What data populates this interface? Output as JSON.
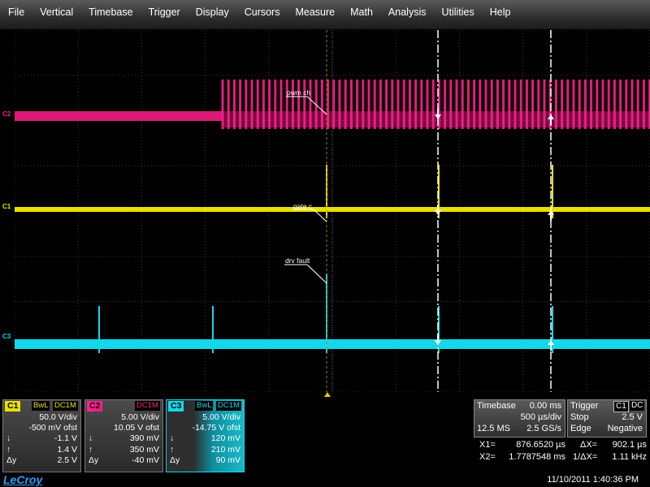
{
  "menu": [
    "File",
    "Vertical",
    "Timebase",
    "Trigger",
    "Display",
    "Cursors",
    "Measure",
    "Math",
    "Analysis",
    "Utilities",
    "Help"
  ],
  "colors": {
    "c1": "#e8e000",
    "c2": "#ff1e8c",
    "c3": "#14d7ea",
    "grid": "#2a2a2a",
    "trigger": "#e8c800"
  },
  "screen": {
    "channel_markers": {
      "c1": "C1",
      "c2": "C2",
      "c3": "C3"
    },
    "traces": {
      "c2": "pwm ch",
      "c1": "gate c",
      "c3": "drv fault"
    }
  },
  "panels": [
    {
      "name": "C1",
      "color": "#e8e000",
      "tags": [
        "BwL",
        "DC1M"
      ],
      "vdiv": "50.0 V/div",
      "ofst": "-500 mV ofst",
      "down": "-1.1 V",
      "up": "1.4 V",
      "dy": "2.5 V"
    },
    {
      "name": "C2",
      "color": "#ff1e8c",
      "tags": [
        "DC1M"
      ],
      "vdiv": "5.00 V/div",
      "ofst": "10.05 V ofst",
      "down": "390 mV",
      "up": "350 mV",
      "dy": "-40 mV"
    },
    {
      "name": "C3",
      "color": "#14d7ea",
      "tags": [
        "BwL",
        "DC1M"
      ],
      "vdiv": "5.00 V/div",
      "ofst": "-14.75 V ofst",
      "down": "120 mV",
      "up": "210 mV",
      "dy": "90 mV"
    }
  ],
  "symbols": {
    "down": "↓",
    "up": "↑",
    "dy": "Δy"
  },
  "timebase": {
    "label": "Timebase",
    "delay": "0.00 ms",
    "div": "500 µs/div",
    "samples": "12.5 MS",
    "rate": "2.5 GS/s"
  },
  "trigger": {
    "label": "Trigger",
    "ch": "C1",
    "coupling": "DC",
    "mode": "Stop",
    "level": "2.5 V",
    "type": "Edge",
    "slope": "Negative"
  },
  "cursors": {
    "x1_label": "X1=",
    "x1": "876.6520 µs",
    "dx_label": "ΔX=",
    "dx": "902.1 µs",
    "x2_label": "X2=",
    "x2": "1.7787548 ms",
    "inv_label": "1/ΔX=",
    "inv": "1.11 kHz"
  },
  "brand": "LeCroy",
  "datetime": "11/10/2011 1:40:36 PM"
}
